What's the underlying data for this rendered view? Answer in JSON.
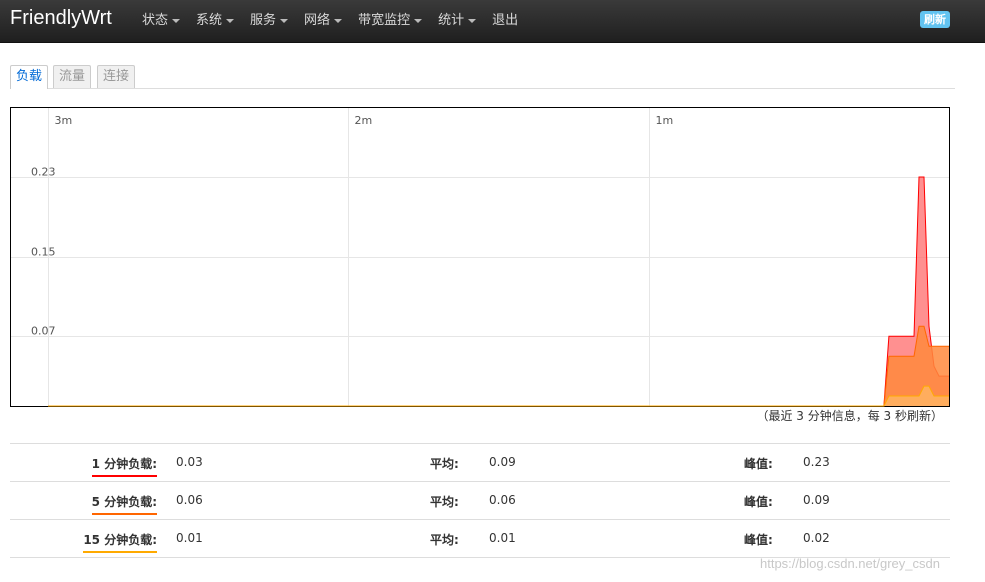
{
  "brand": "FriendlyWrt",
  "menu": [
    {
      "label": "状态",
      "dropdown": true
    },
    {
      "label": "系统",
      "dropdown": true
    },
    {
      "label": "服务",
      "dropdown": true
    },
    {
      "label": "网络",
      "dropdown": true
    },
    {
      "label": "带宽监控",
      "dropdown": true
    },
    {
      "label": "统计",
      "dropdown": true
    },
    {
      "label": "退出",
      "dropdown": false
    }
  ],
  "refresh_label": "刷新",
  "tabs": [
    {
      "label": "负载",
      "active": true
    },
    {
      "label": "流量",
      "active": false
    },
    {
      "label": "连接",
      "active": false
    }
  ],
  "chart_note": "（最近 3 分钟信息，每 3 秒刷新）",
  "chart_data": {
    "type": "area",
    "x_ticks": [
      "3m",
      "2m",
      "1m"
    ],
    "y_ticks": [
      "0.23",
      "0.15",
      "0.07"
    ],
    "series": [
      {
        "name": "1 分钟负载",
        "color": "#ff0000",
        "points": [
          [
            -180,
            0
          ],
          [
            -13,
            0
          ],
          [
            -12,
            0.07
          ],
          [
            -7,
            0.07
          ],
          [
            -6,
            0.23
          ],
          [
            -5,
            0.23
          ],
          [
            -4,
            0.08
          ],
          [
            -3,
            0.04
          ],
          [
            -2,
            0.03
          ],
          [
            0,
            0.03
          ]
        ]
      },
      {
        "name": "5 分钟负载",
        "color": "#ff6600",
        "points": [
          [
            -180,
            0
          ],
          [
            -13,
            0
          ],
          [
            -12,
            0.05
          ],
          [
            -7,
            0.05
          ],
          [
            -6,
            0.08
          ],
          [
            -5,
            0.08
          ],
          [
            -4,
            0.06
          ],
          [
            0,
            0.06
          ]
        ]
      },
      {
        "name": "15 分钟负载",
        "color": "#ffaa00",
        "points": [
          [
            -180,
            0
          ],
          [
            -13,
            0
          ],
          [
            -12,
            0.01
          ],
          [
            -6,
            0.01
          ],
          [
            -5,
            0.02
          ],
          [
            -4,
            0.02
          ],
          [
            -3,
            0.01
          ],
          [
            0,
            0.01
          ]
        ]
      }
    ]
  },
  "stats": {
    "avg_label": "平均:",
    "peak_label": "峰值:",
    "rows": [
      {
        "label": "1 分钟负载:",
        "color": "#ff0000",
        "current": "0.03",
        "avg": "0.09",
        "peak": "0.23"
      },
      {
        "label": "5 分钟负载:",
        "color": "#ff6600",
        "current": "0.06",
        "avg": "0.06",
        "peak": "0.09"
      },
      {
        "label": "15 分钟负载:",
        "color": "#ffaa00",
        "current": "0.01",
        "avg": "0.01",
        "peak": "0.02"
      }
    ]
  },
  "watermark": "https://blog.csdn.net/grey_csdn"
}
